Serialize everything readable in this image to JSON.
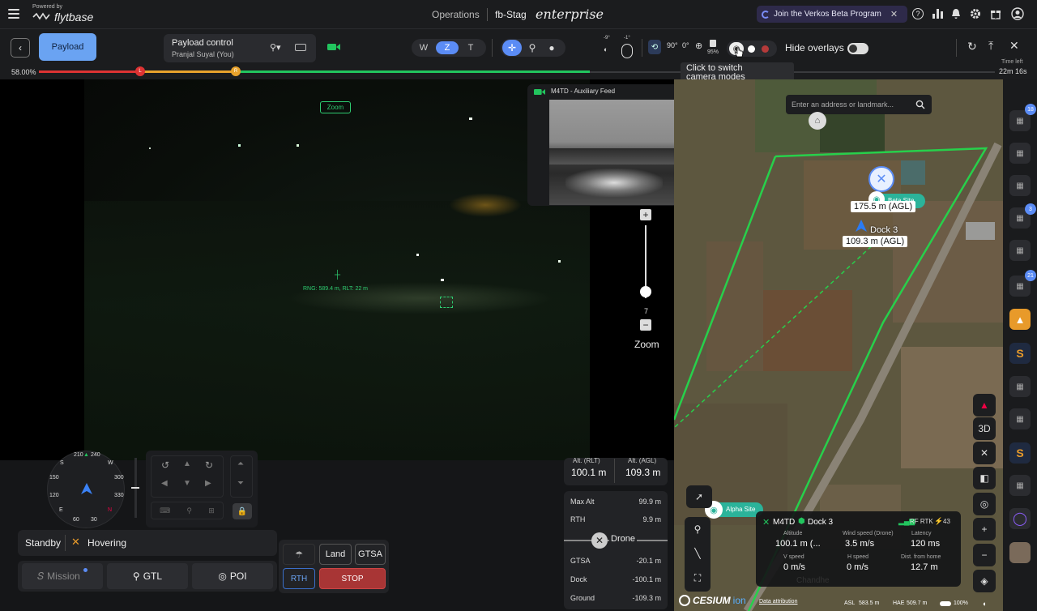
{
  "topbar": {
    "powered_by": "Powered by",
    "brand": "flytbase",
    "operations": "Operations",
    "org": "fb-Stag",
    "edition": "enterprise",
    "beta_label": "Join the Verkos Beta Program",
    "beta_close": "✕"
  },
  "controls": {
    "payload_label": "Payload",
    "payload_control_title": "Payload control",
    "payload_control_user": "Pranjal Suyal (You)",
    "lens_w": "W",
    "lens_z": "Z",
    "lens_t": "T",
    "gimbal_pitch": "-9°",
    "gimbal_yaw": "-1°",
    "angle_90": "90°",
    "angle_0": "0°",
    "storage_pct": "95%",
    "hide_overlays": "Hide overlays",
    "time_left_label": "Time left",
    "time_left_value": "22m 16s",
    "tooltip_line1": "Click to switch",
    "tooltip_line2": "camera modes"
  },
  "battery": {
    "percent_label": "58.00%",
    "percent": 58,
    "marker_l": "L",
    "marker_r": "R"
  },
  "video": {
    "zoom_tag": "Zoom",
    "range_text": "RNG: 589.4 m, RLT: 22 m",
    "zoom_plus": "+",
    "zoom_minus": "−",
    "zoom_level": "7",
    "zoom_label": "Zoom",
    "aux_title": "M4TD - Auxiliary Feed"
  },
  "compass": {
    "heading_top": "210",
    "heading_top2": "240",
    "dir_s": "S",
    "dir_w": "W",
    "dir_e": "E",
    "t150": "150",
    "t120": "120",
    "t300": "300",
    "t330": "330",
    "t60": "60",
    "t30": "30",
    "n_mark": "N"
  },
  "status": {
    "mode": "Standby",
    "state": "Hovering",
    "mission": "Mission",
    "gtl": "GTL",
    "poi": "POI",
    "land": "Land",
    "gtsa": "GTSA",
    "rth": "RTH",
    "stop": "STOP"
  },
  "telemetry": {
    "alt_rlt_label": "Alt. (RLT)",
    "alt_rlt_value": "100.1 m",
    "alt_agl_label": "Alt. (AGL)",
    "alt_agl_value": "109.3 m",
    "max_alt_label": "Max Alt",
    "max_alt_value": "99.9 m",
    "rth_label": "RTH",
    "rth_value": "9.9 m",
    "drone_label": "Drone",
    "gtsa_label": "GTSA",
    "gtsa_value": "-20.1 m",
    "dock_label": "Dock",
    "dock_value": "-100.1 m",
    "ground_label": "Ground",
    "ground_value": "-109.3 m"
  },
  "map": {
    "search_placeholder": "Enter an address or landmark...",
    "drone_alt": "175.5 m (AGL)",
    "site_label_top": "Beta Site",
    "dock_name": "Dock 3",
    "dock_alt": "109.3 m (AGL)",
    "alpha_site": "Alpha Site",
    "btn_3d": "3D",
    "btn_plus": "+",
    "btn_minus": "−",
    "cesium": "CESIUM",
    "cesium_ion": "ion",
    "attribution": "Data attribution",
    "asl_label": "ASL",
    "asl_value": "583.5 m",
    "hae_label": "HAE",
    "hae_value": "509.7 m",
    "battery_pct": "100%",
    "town": "Chandhe"
  },
  "info_card": {
    "drone": "M4TD",
    "dock": "Dock 3",
    "rtk": "RF RTK",
    "sats": "43",
    "altitude_label": "Altitude",
    "altitude_value": "100.1 m (...",
    "wind_label": "Wind speed (Drone)",
    "wind_value": "3.5 m/s",
    "latency_label": "Latency",
    "latency_value": "120 ms",
    "vspeed_label": "V speed",
    "vspeed_value": "0 m/s",
    "hspeed_label": "H speed",
    "hspeed_value": "0 m/s",
    "dist_label": "Dist. from home",
    "dist_value": "12.7 m"
  },
  "rightbar": {
    "badge1": "18",
    "badge2": "3",
    "badge3": "21"
  },
  "colors": {
    "accent": "#5b8cf5",
    "green": "#22c55e",
    "stop": "#b83b3b",
    "teal": "#2bb39a"
  }
}
